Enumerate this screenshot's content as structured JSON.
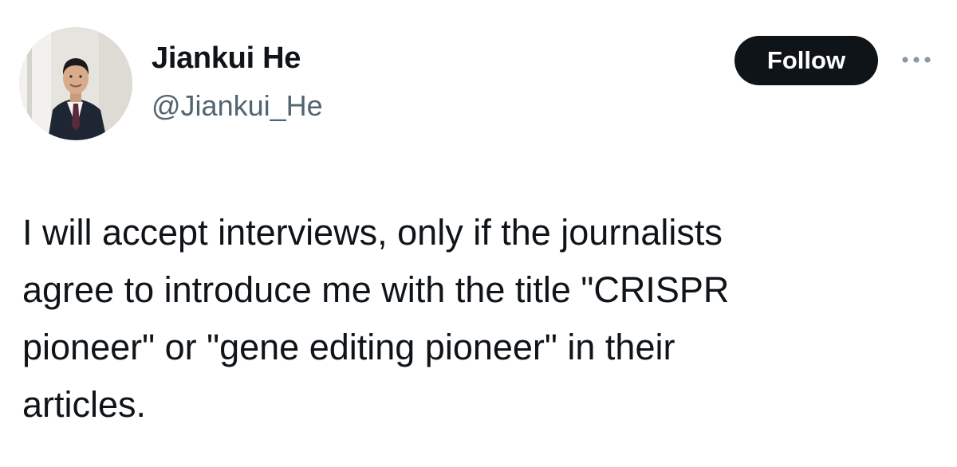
{
  "author": {
    "display_name": "Jiankui He",
    "handle": "@Jiankui_He",
    "avatar_icon": "profile-photo"
  },
  "actions": {
    "follow_label": "Follow",
    "more_icon": "more-options-icon"
  },
  "tweet": {
    "lines": [
      "I will accept interviews, only if the journalists",
      "agree to introduce me with the title \"CRISPR",
      "pioneer\" or \"gene editing pioneer\" in their",
      "articles."
    ]
  },
  "colors": {
    "text_primary": "#0f1419",
    "text_secondary": "#536471",
    "follow_background": "#0f1419",
    "follow_text": "#ffffff",
    "background": "#ffffff"
  }
}
